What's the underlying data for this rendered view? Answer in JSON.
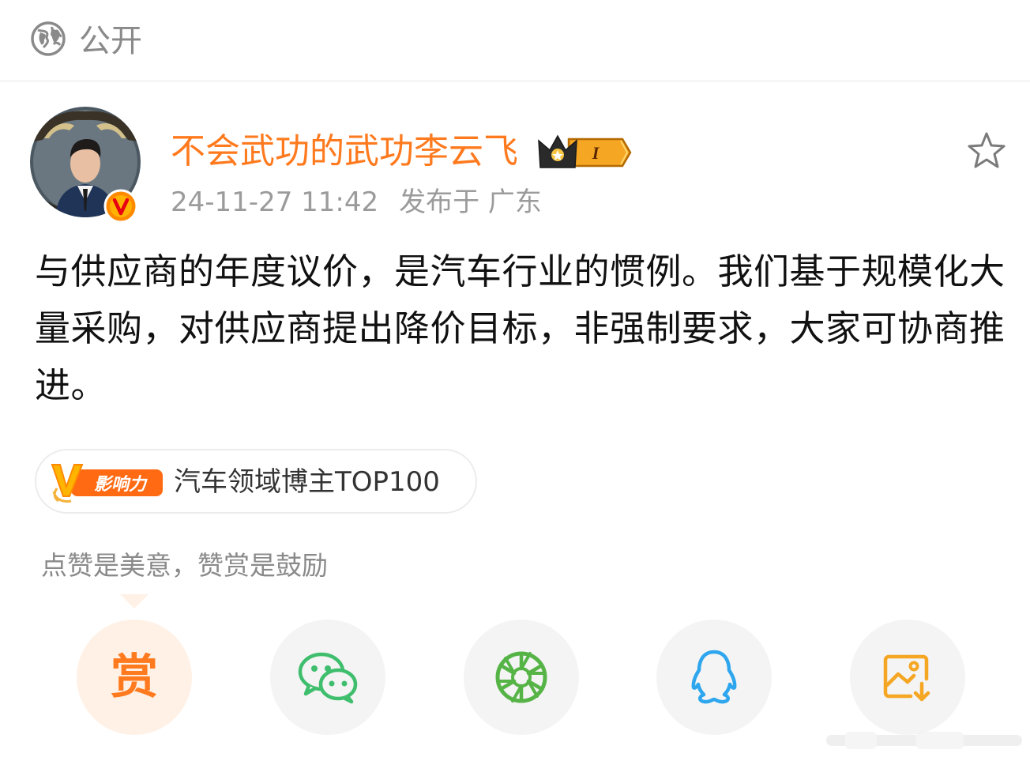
{
  "top_bar": {
    "visibility_icon": "globe-icon",
    "visibility_label": "公开"
  },
  "post": {
    "author": {
      "name": "不会武功的武功李云飞",
      "verified_icon": "verified-v-icon",
      "crown_badge_icon": "crown-level-badge-icon",
      "crown_badge_text": "I"
    },
    "timestamp": "24-11-27 11:42",
    "location": "发布于 广东",
    "favorite_icon": "star-outline-icon",
    "text": "与供应商的年度议价，是汽车行业的惯例。我们基于规模化大量采购，对供应商提出降价目标，非强制要求，大家可协商推进。"
  },
  "influence": {
    "logo_icon": "influence-v-logo-icon",
    "logo_text": "影响力",
    "label": "汽车领域博主TOP100"
  },
  "reward_hint": "点赞是美意，赞赏是鼓励",
  "share": {
    "buttons": [
      {
        "name": "reward",
        "label": "赏",
        "icon": "reward-icon",
        "color": "#ff7a1e"
      },
      {
        "name": "wechat",
        "icon": "wechat-icon",
        "color": "#3fbe6d"
      },
      {
        "name": "moments",
        "icon": "moments-aperture-icon",
        "color": "#56b447"
      },
      {
        "name": "qq",
        "icon": "qq-penguin-icon",
        "color": "#2ea6ee"
      },
      {
        "name": "save-image",
        "icon": "save-image-icon",
        "color": "#f5a623"
      }
    ]
  }
}
